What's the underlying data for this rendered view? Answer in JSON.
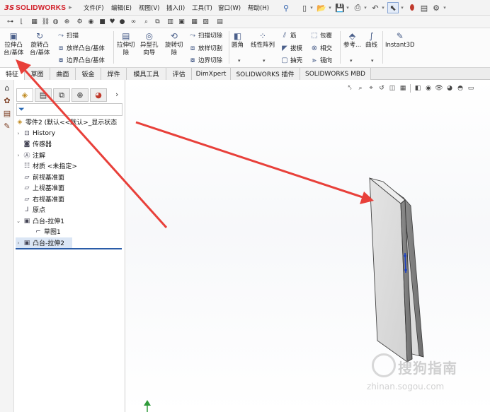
{
  "app": {
    "logo_ds": "3S",
    "logo_brand": "SOLIDWORKS"
  },
  "menu": [
    "文件(F)",
    "编辑(E)",
    "视图(V)",
    "插入(I)",
    "工具(T)",
    "窗口(W)",
    "帮助(H)"
  ],
  "features_toolbar": {
    "extrude_boss": "拉伸凸\n台/基体",
    "revolve_boss": "旋转凸\n台/基体",
    "sweep": "扫描",
    "loft_boss": "放样凸台/基体",
    "boundary_boss": "边界凸台/基体",
    "extrude_cut": "拉伸切\n除",
    "hole_wizard": "异型孔\n向导",
    "revolve_cut": "旋转切\n除",
    "swept_cut": "扫描切除",
    "lofted_cut": "放样切割",
    "boundary_cut": "边界切除",
    "fillet": "圆角",
    "linear_pattern": "线性阵列",
    "rib": "筋",
    "draft": "拔模",
    "shell": "抽壳",
    "wrap": "包覆",
    "intersect": "相交",
    "mirror": "镜向",
    "reference": "参考...",
    "curves": "曲线",
    "instant3d": "Instant3D"
  },
  "tabs": [
    "特征",
    "草图",
    "曲面",
    "钣金",
    "焊件",
    "模具工具",
    "评估",
    "DimXpert",
    "SOLIDWORKS 插件",
    "SOLIDWORKS MBD"
  ],
  "active_tab": "特征",
  "tree": {
    "root": "零件2 (默认<<默认>_显示状态",
    "items": [
      {
        "label": "History"
      },
      {
        "label": "传感器"
      },
      {
        "label": "注解"
      },
      {
        "label": "材质 <未指定>"
      },
      {
        "label": "前视基准面"
      },
      {
        "label": "上视基准面"
      },
      {
        "label": "右视基准面"
      },
      {
        "label": "原点"
      },
      {
        "label": "凸台-拉伸1"
      },
      {
        "label": "草图1"
      },
      {
        "label": "凸台-拉伸2"
      }
    ]
  },
  "watermark": {
    "text": "搜狗指南",
    "url": "zhinan.sogou.com"
  },
  "colors": {
    "brand_red": "#d2202a",
    "arrow_red": "#e8403a",
    "selection_blue": "#2a5ca8"
  }
}
